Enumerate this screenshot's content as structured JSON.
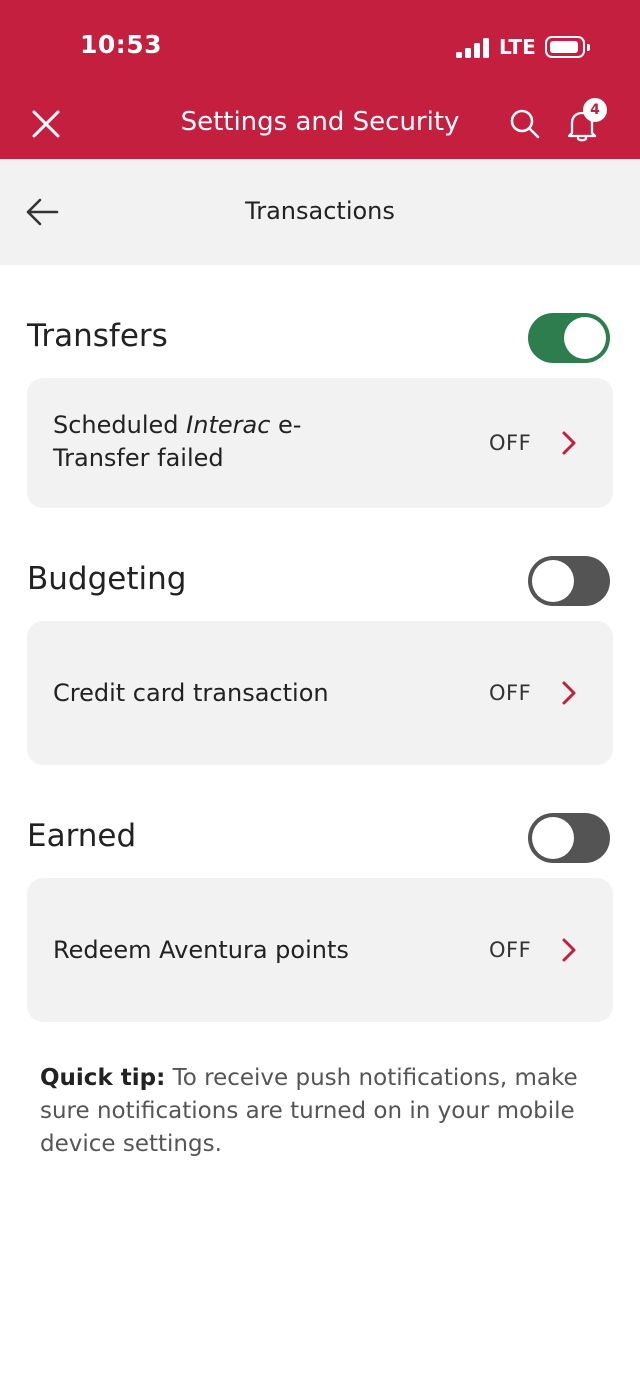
{
  "status_bar": {
    "time": "10:53",
    "network": "LTE"
  },
  "app_bar": {
    "title": "Settings and Security",
    "notification_count": "4",
    "brand_color": "#c41f3e"
  },
  "sub_header": {
    "title": "Transactions"
  },
  "sections": [
    {
      "title": "Transfers",
      "toggle_on": true,
      "item": {
        "label_pre": "Scheduled ",
        "label_italic": "Interac",
        "label_post": " e-",
        "label_line2": "Transfer failed",
        "status": "OFF"
      }
    },
    {
      "title": "Budgeting",
      "toggle_on": false,
      "item": {
        "label": "Credit card transaction",
        "status": "OFF"
      }
    },
    {
      "title": "Earned",
      "toggle_on": false,
      "item": {
        "label": "Redeem Aventura points",
        "status": "OFF"
      }
    }
  ],
  "tip": {
    "heading": "Quick tip:",
    "text": " To receive push notifications, make sure notifications are turned on in your mobile device settings."
  },
  "icons": [
    "close-icon",
    "search-icon",
    "bell-icon",
    "back-arrow-icon",
    "chevron-right-icon",
    "signal-icon",
    "battery-icon"
  ],
  "colors": {
    "accent": "#c41f3e",
    "toggle_on": "#2e7d4f",
    "toggle_off": "#545454",
    "card_bg": "#f2f2f2"
  }
}
